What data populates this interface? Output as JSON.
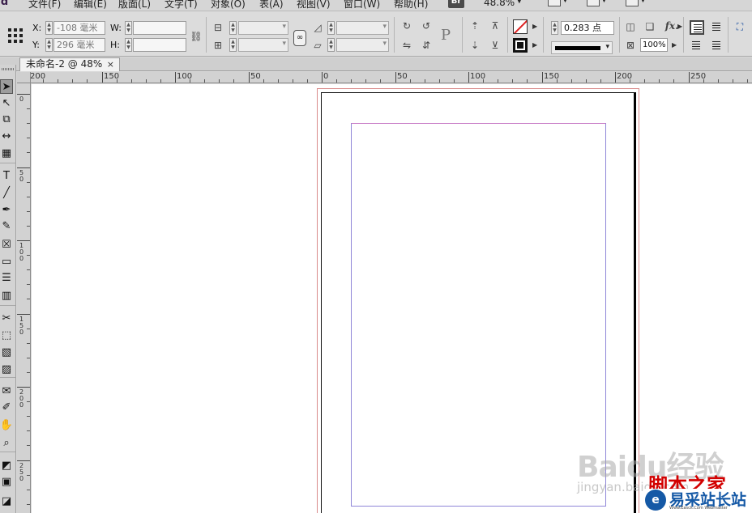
{
  "menu": {
    "logo": "Id",
    "items": [
      "文件(F)",
      "编辑(E)",
      "版面(L)",
      "文字(T)",
      "对象(O)",
      "表(A)",
      "视图(V)",
      "窗口(W)",
      "帮助(H)"
    ],
    "bridge": "Br",
    "zoom": "48.8%"
  },
  "control": {
    "x_label": "X:",
    "x_value": "-108 毫米",
    "y_label": "Y:",
    "y_value": "296 毫米",
    "w_label": "W:",
    "w_value": "",
    "h_label": "H:",
    "h_value": "",
    "stroke_weight": "0.283 点",
    "opacity": "100%",
    "fx": "fx.",
    "p_glyph": "P"
  },
  "document": {
    "tab_title": "未命名-2 @ 48%",
    "close_glyph": "×"
  },
  "ruler": {
    "h_labels": [
      "200",
      "150",
      "100",
      "50",
      "0",
      "50",
      "100",
      "150",
      "200",
      "250"
    ],
    "v_labels": [
      "0",
      "5 0",
      "1 0 0",
      "1 5 0",
      "2 0 0",
      "2 5 0"
    ]
  },
  "tools": [
    {
      "name": "selection-tool-icon",
      "glyph": "➤",
      "active": true
    },
    {
      "name": "direct-selection-tool-icon",
      "glyph": "↖"
    },
    {
      "name": "page-tool-icon",
      "glyph": "⧉"
    },
    {
      "name": "gap-tool-icon",
      "glyph": "↔"
    },
    {
      "name": "content-collector-icon",
      "glyph": "▦"
    },
    {
      "name": "type-tool-icon",
      "glyph": "T"
    },
    {
      "name": "line-tool-icon",
      "glyph": "╱"
    },
    {
      "name": "pen-tool-icon",
      "glyph": "✒"
    },
    {
      "name": "pencil-tool-icon",
      "glyph": "✎"
    },
    {
      "name": "rectangle-frame-tool-icon",
      "glyph": "☒"
    },
    {
      "name": "rectangle-tool-icon",
      "glyph": "▭"
    },
    {
      "name": "horizontal-grid-tool-icon",
      "glyph": "☰"
    },
    {
      "name": "vertical-grid-tool-icon",
      "glyph": "▥"
    },
    {
      "name": "scissors-tool-icon",
      "glyph": "✂"
    },
    {
      "name": "free-transform-tool-icon",
      "glyph": "⬚"
    },
    {
      "name": "gradient-swatch-tool-icon",
      "glyph": "▧"
    },
    {
      "name": "gradient-feather-tool-icon",
      "glyph": "▨"
    },
    {
      "name": "note-tool-icon",
      "glyph": "✉"
    },
    {
      "name": "eyedropper-tool-icon",
      "glyph": "✐"
    },
    {
      "name": "hand-tool-icon",
      "glyph": "✋"
    },
    {
      "name": "zoom-tool-icon",
      "glyph": "⌕"
    },
    {
      "name": "fill-stroke-icon",
      "glyph": "◩"
    },
    {
      "name": "formatting-affects-icon",
      "glyph": "▣"
    },
    {
      "name": "view-mode-icon",
      "glyph": "◪"
    }
  ],
  "watermarks": {
    "baidu": "Baidu经验",
    "jingyan": "jingyan.baidu.com",
    "jiaoben": "脚本之家",
    "site_logo": "e",
    "site_name": "易采站长站",
    "site_url": "Www.Easck.Com Webmaster"
  },
  "colors": {
    "bleed_guide": "#d98b8b",
    "margin_guide": "#8f86d8",
    "margin_top_guide": "#c77ac6",
    "jiaoben_red": "#d20000",
    "site_blue": "#1559a6"
  }
}
